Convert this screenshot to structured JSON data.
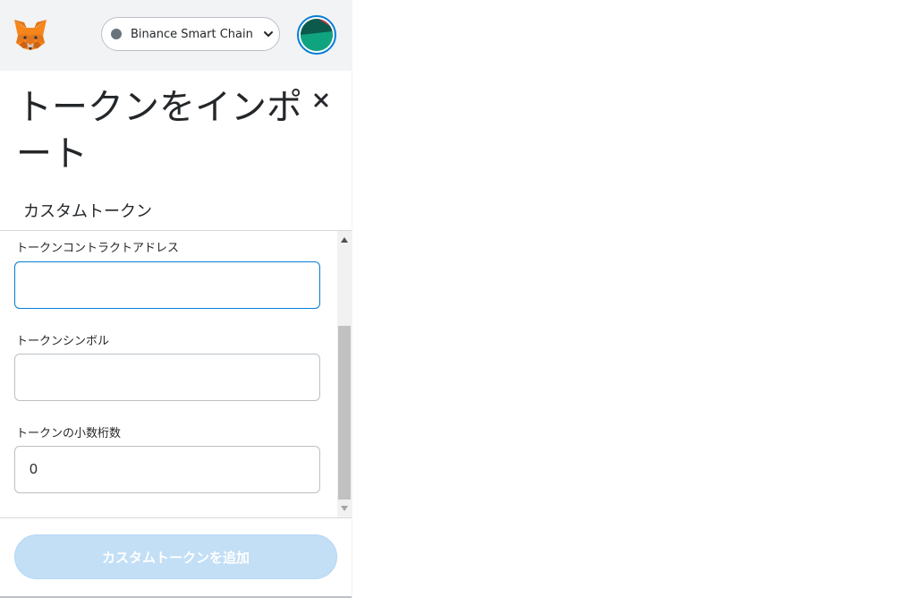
{
  "header": {
    "network": {
      "label": "Binance Smart Chain",
      "dot_color": "#6a737d"
    },
    "icons": {
      "logo": "metamask-fox-icon",
      "network_chevron": "chevron-down-icon",
      "account": "account-avatar-icon"
    }
  },
  "page": {
    "title": "トークンをインポート",
    "close_icon": "close-icon"
  },
  "tabs": {
    "custom": "カスタムトークン"
  },
  "form": {
    "address": {
      "label": "トークンコントラクトアドレス",
      "value": ""
    },
    "symbol": {
      "label": "トークンシンボル",
      "value": ""
    },
    "decimals": {
      "label": "トークンの小数桁数",
      "value": "0"
    }
  },
  "actions": {
    "add_custom_token": "カスタムトークンを追加"
  },
  "colors": {
    "accent": "#037dd6",
    "header_bg": "#f2f3f4",
    "button_disabled_bg": "#c2dff6"
  }
}
